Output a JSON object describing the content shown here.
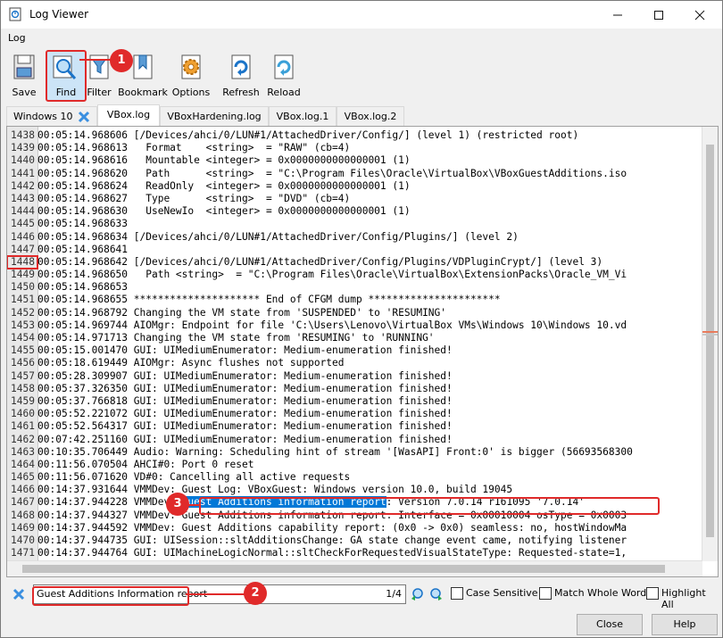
{
  "window": {
    "title": "Log Viewer",
    "min_icon": "minimize-icon",
    "max_icon": "maximize-icon",
    "close_icon": "close-icon"
  },
  "menu": {
    "items": [
      "Log"
    ]
  },
  "toolbar": {
    "buttons": [
      {
        "label": "Save",
        "icon": "save-icon"
      },
      {
        "label": "Find",
        "icon": "find-icon"
      },
      {
        "label": "Filter",
        "icon": "filter-icon"
      },
      {
        "label": "Bookmark",
        "icon": "bookmark-icon"
      },
      {
        "label": "Options",
        "icon": "options-gear-icon"
      },
      {
        "label": "Refresh",
        "icon": "refresh-icon"
      },
      {
        "label": "Reload",
        "icon": "reload-icon"
      }
    ]
  },
  "tabs": [
    {
      "label": "Windows 10",
      "active": false
    },
    {
      "label": "VBox.log",
      "active": true
    },
    {
      "label": "VBoxHardening.log",
      "active": false
    },
    {
      "label": "VBox.log.1",
      "active": false
    },
    {
      "label": "VBox.log.2",
      "active": false
    }
  ],
  "log": {
    "lines": [
      {
        "n": "1438",
        "t": "00:05:14.968606 [/Devices/ahci/0/LUN#1/AttachedDriver/Config/] (level 1) (restricted root)"
      },
      {
        "n": "1439",
        "t": "00:05:14.968613   Format    <string>  = \"RAW\" (cb=4)"
      },
      {
        "n": "1440",
        "t": "00:05:14.968616   Mountable <integer> = 0x0000000000000001 (1)"
      },
      {
        "n": "1441",
        "t": "00:05:14.968620   Path      <string>  = \"C:\\Program Files\\Oracle\\VirtualBox\\VBoxGuestAdditions.iso"
      },
      {
        "n": "1442",
        "t": "00:05:14.968624   ReadOnly  <integer> = 0x0000000000000001 (1)"
      },
      {
        "n": "1443",
        "t": "00:05:14.968627   Type      <string>  = \"DVD\" (cb=4)"
      },
      {
        "n": "1444",
        "t": "00:05:14.968630   UseNewIo  <integer> = 0x0000000000000001 (1)"
      },
      {
        "n": "1445",
        "t": "00:05:14.968633"
      },
      {
        "n": "1446",
        "t": "00:05:14.968634 [/Devices/ahci/0/LUN#1/AttachedDriver/Config/Plugins/] (level 2)"
      },
      {
        "n": "1447",
        "t": "00:05:14.968641"
      },
      {
        "n": "1448",
        "t": "00:05:14.968642 [/Devices/ahci/0/LUN#1/AttachedDriver/Config/Plugins/VDPluginCrypt/] (level 3)"
      },
      {
        "n": "1449",
        "t": "00:05:14.968650   Path <string>  = \"C:\\Program Files\\Oracle\\VirtualBox\\ExtensionPacks\\Oracle_VM_Vi"
      },
      {
        "n": "1450",
        "t": "00:05:14.968653"
      },
      {
        "n": "1451",
        "t": "00:05:14.968655 ********************* End of CFGM dump **********************"
      },
      {
        "n": "1452",
        "t": "00:05:14.968792 Changing the VM state from 'SUSPENDED' to 'RESUMING'"
      },
      {
        "n": "1453",
        "t": "00:05:14.969744 AIOMgr: Endpoint for file 'C:\\Users\\Lenovo\\VirtualBox VMs\\Windows 10\\Windows 10.vd"
      },
      {
        "n": "1454",
        "t": "00:05:14.971713 Changing the VM state from 'RESUMING' to 'RUNNING'"
      },
      {
        "n": "1455",
        "t": "00:05:15.001470 GUI: UIMediumEnumerator: Medium-enumeration finished!"
      },
      {
        "n": "1456",
        "t": "00:05:18.619449 AIOMgr: Async flushes not supported"
      },
      {
        "n": "1457",
        "t": "00:05:28.309907 GUI: UIMediumEnumerator: Medium-enumeration finished!"
      },
      {
        "n": "1458",
        "t": "00:05:37.326350 GUI: UIMediumEnumerator: Medium-enumeration finished!"
      },
      {
        "n": "1459",
        "t": "00:05:37.766818 GUI: UIMediumEnumerator: Medium-enumeration finished!"
      },
      {
        "n": "1460",
        "t": "00:05:52.221072 GUI: UIMediumEnumerator: Medium-enumeration finished!"
      },
      {
        "n": "1461",
        "t": "00:05:52.564317 GUI: UIMediumEnumerator: Medium-enumeration finished!"
      },
      {
        "n": "1462",
        "t": "00:07:42.251160 GUI: UIMediumEnumerator: Medium-enumeration finished!"
      },
      {
        "n": "1463",
        "t": "00:10:35.706449 Audio: Warning: Scheduling hint of stream '[WasAPI] Front:0' is bigger (56693568300"
      },
      {
        "n": "1464",
        "t": "00:11:56.070504 AHCI#0: Port 0 reset"
      },
      {
        "n": "1465",
        "t": "00:11:56.071620 VD#0: Cancelling all active requests"
      },
      {
        "n": "1466",
        "t": "00:14:37.931644 VMMDev: Guest Log: VBoxGuest: Windows version 10.0, build 19045"
      },
      {
        "n": "1467",
        "pre": "00:14:37.944228 VMMDev: ",
        "sel": "Guest Additions information report",
        "post": ": Version 7.0.14 r161095 '7.0.14'"
      },
      {
        "n": "1468",
        "t": "00:14:37.944327 VMMDev: Guest Additions information report: Interface = 0x00010004 osType = 0x0003"
      },
      {
        "n": "1469",
        "t": "00:14:37.944592 VMMDev: Guest Additions capability report: (0x0 -> 0x0) seamless: no, hostWindowMa"
      },
      {
        "n": "1470",
        "t": "00:14:37.944735 GUI: UISession::sltAdditionsChange: GA state change event came, notifying listener"
      },
      {
        "n": "1471",
        "t": "00:14:37.944764 GUI: UIMachineLogicNormal::sltCheckForRequestedVisualStateType: Requested-state=1,"
      }
    ]
  },
  "findbar": {
    "close_icon": "close-x-icon",
    "value": "Guest Additions Information report",
    "count": "1/4",
    "prev_icon": "find-previous-icon",
    "next_icon": "find-next-icon",
    "options": [
      {
        "label": "Case Sensitive",
        "checked": false
      },
      {
        "label": "Match Whole Word",
        "checked": false
      },
      {
        "label": "Highlight All",
        "checked": false
      }
    ]
  },
  "buttons": {
    "close": "Close",
    "help": "Help"
  },
  "callouts": [
    "1",
    "2",
    "3"
  ],
  "colors": {
    "accent": "#e02a2a",
    "selection": "#0078d7",
    "find_active_bg": "#cce4f7"
  }
}
